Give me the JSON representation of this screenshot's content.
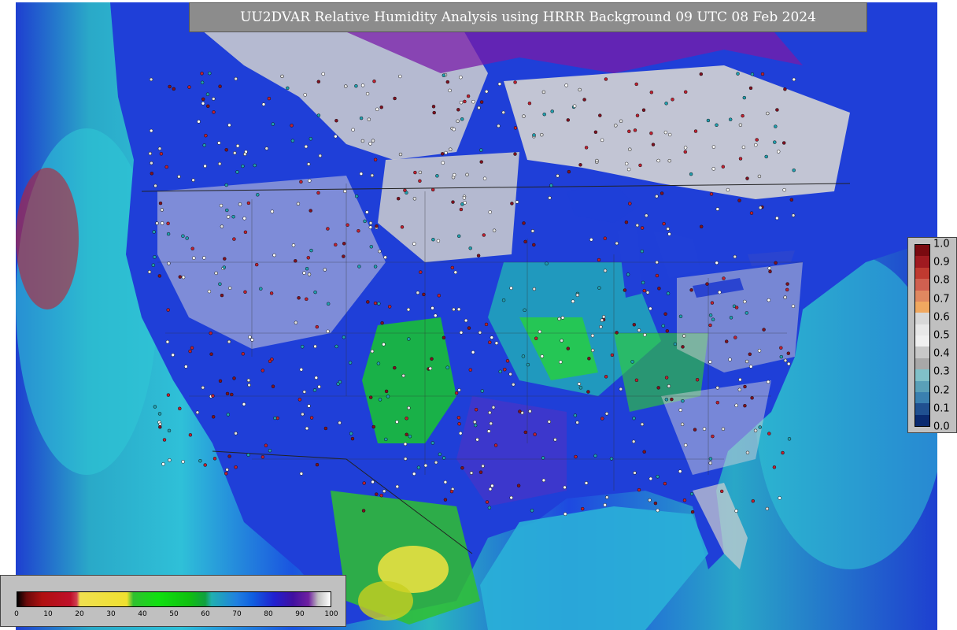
{
  "title": "UU2DVAR Relative Humidity Analysis using HRRR Background 09 UTC 08 Feb 2024",
  "rh_colorbar": {
    "ticks": [
      "0",
      "10",
      "20",
      "30",
      "40",
      "50",
      "60",
      "70",
      "80",
      "90",
      "100"
    ]
  },
  "station_colorbar": {
    "ticks": [
      "1.0",
      "0.9",
      "0.8",
      "0.7",
      "0.6",
      "0.5",
      "0.4",
      "0.3",
      "0.2",
      "0.1",
      "0.0"
    ],
    "colors": [
      "#7a0a10",
      "#a01a20",
      "#c03a30",
      "#d06050",
      "#e08860",
      "#f0a860",
      "#d8d8d8",
      "#e8e8e8",
      "#f0f0f0",
      "#c8c8c8",
      "#a8a8a8",
      "#80c0c8",
      "#5aa0b8",
      "#3a80b0",
      "#205090",
      "#0a2a70"
    ]
  }
}
